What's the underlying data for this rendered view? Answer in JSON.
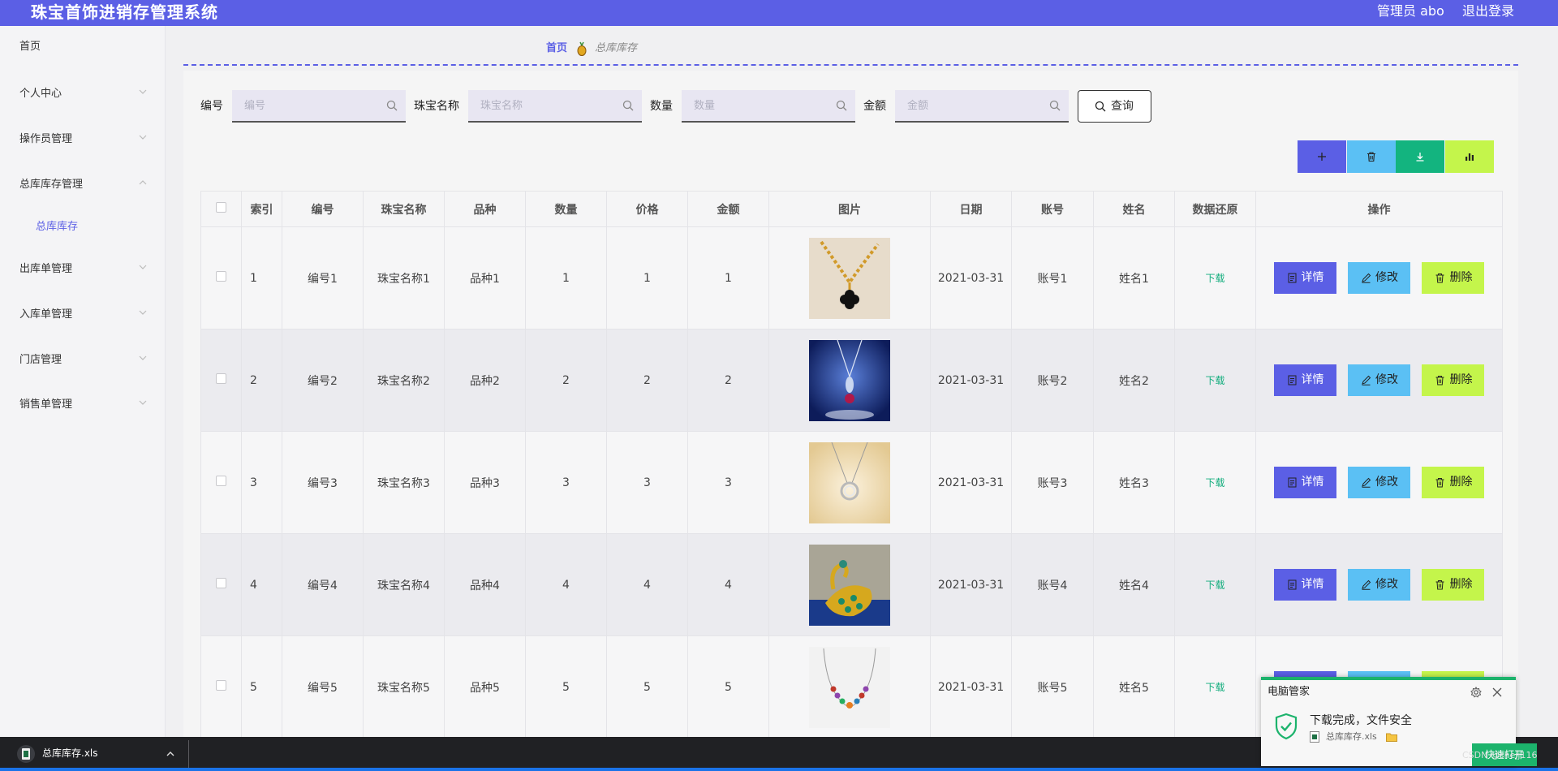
{
  "header": {
    "title": "珠宝首饰进销存管理系统",
    "admin": "管理员 abo",
    "logout": "退出登录"
  },
  "sidebar": {
    "items": [
      {
        "label": "首页"
      },
      {
        "label": "个人中心"
      },
      {
        "label": "操作员管理"
      },
      {
        "label": "总库库存管理"
      },
      {
        "label": "总库库存"
      },
      {
        "label": "出库单管理"
      },
      {
        "label": "入库单管理"
      },
      {
        "label": "门店管理"
      },
      {
        "label": "销售单管理"
      }
    ]
  },
  "breadcrumb": {
    "home": "首页",
    "current": "总库库存"
  },
  "search": {
    "fields": [
      {
        "label": "编号",
        "placeholder": "编号"
      },
      {
        "label": "珠宝名称",
        "placeholder": "珠宝名称"
      },
      {
        "label": "数量",
        "placeholder": "数量"
      },
      {
        "label": "金额",
        "placeholder": "金额"
      }
    ],
    "query_label": "查询"
  },
  "toolbar": {
    "add_icon": "plus-icon",
    "delete_icon": "trash-icon",
    "export_icon": "download-icon",
    "chart_icon": "bar-chart-icon",
    "colors": {
      "add": "#5b5fe5",
      "delete": "#5bc0f4",
      "export": "#13b47f",
      "chart": "#c4f54b"
    }
  },
  "table": {
    "headers": [
      "索引",
      "编号",
      "珠宝名称",
      "品种",
      "数量",
      "价格",
      "金额",
      "图片",
      "日期",
      "账号",
      "姓名",
      "数据还原",
      "操作"
    ],
    "rows": [
      {
        "idx": "1",
        "code": "编号1",
        "name": "珠宝名称1",
        "variety": "品种1",
        "qty": "1",
        "price": "1",
        "amount": "1",
        "date": "2021-03-31",
        "account": "账号1",
        "person": "姓名1",
        "restore": "下载"
      },
      {
        "idx": "2",
        "code": "编号2",
        "name": "珠宝名称2",
        "variety": "品种2",
        "qty": "2",
        "price": "2",
        "amount": "2",
        "date": "2021-03-31",
        "account": "账号2",
        "person": "姓名2",
        "restore": "下载"
      },
      {
        "idx": "3",
        "code": "编号3",
        "name": "珠宝名称3",
        "variety": "品种3",
        "qty": "3",
        "price": "3",
        "amount": "3",
        "date": "2021-03-31",
        "account": "账号3",
        "person": "姓名3",
        "restore": "下载"
      },
      {
        "idx": "4",
        "code": "编号4",
        "name": "珠宝名称4",
        "variety": "品种4",
        "qty": "4",
        "price": "4",
        "amount": "4",
        "date": "2021-03-31",
        "account": "账号4",
        "person": "姓名4",
        "restore": "下载"
      },
      {
        "idx": "5",
        "code": "编号5",
        "name": "珠宝名称5",
        "variety": "品种5",
        "qty": "5",
        "price": "5",
        "amount": "5",
        "date": "2021-03-31",
        "account": "账号5",
        "person": "姓名5",
        "restore": "下载"
      }
    ],
    "actions": {
      "detail": "详情",
      "edit": "修改",
      "delete": "删除"
    }
  },
  "downloads": {
    "file": "总库库存.xls"
  },
  "popup": {
    "title": "电脑管家",
    "message": "下载完成，文件安全",
    "file": "总库库存.xls",
    "open_label": "快速打开"
  },
  "watermark": "CSDN @shejj116"
}
